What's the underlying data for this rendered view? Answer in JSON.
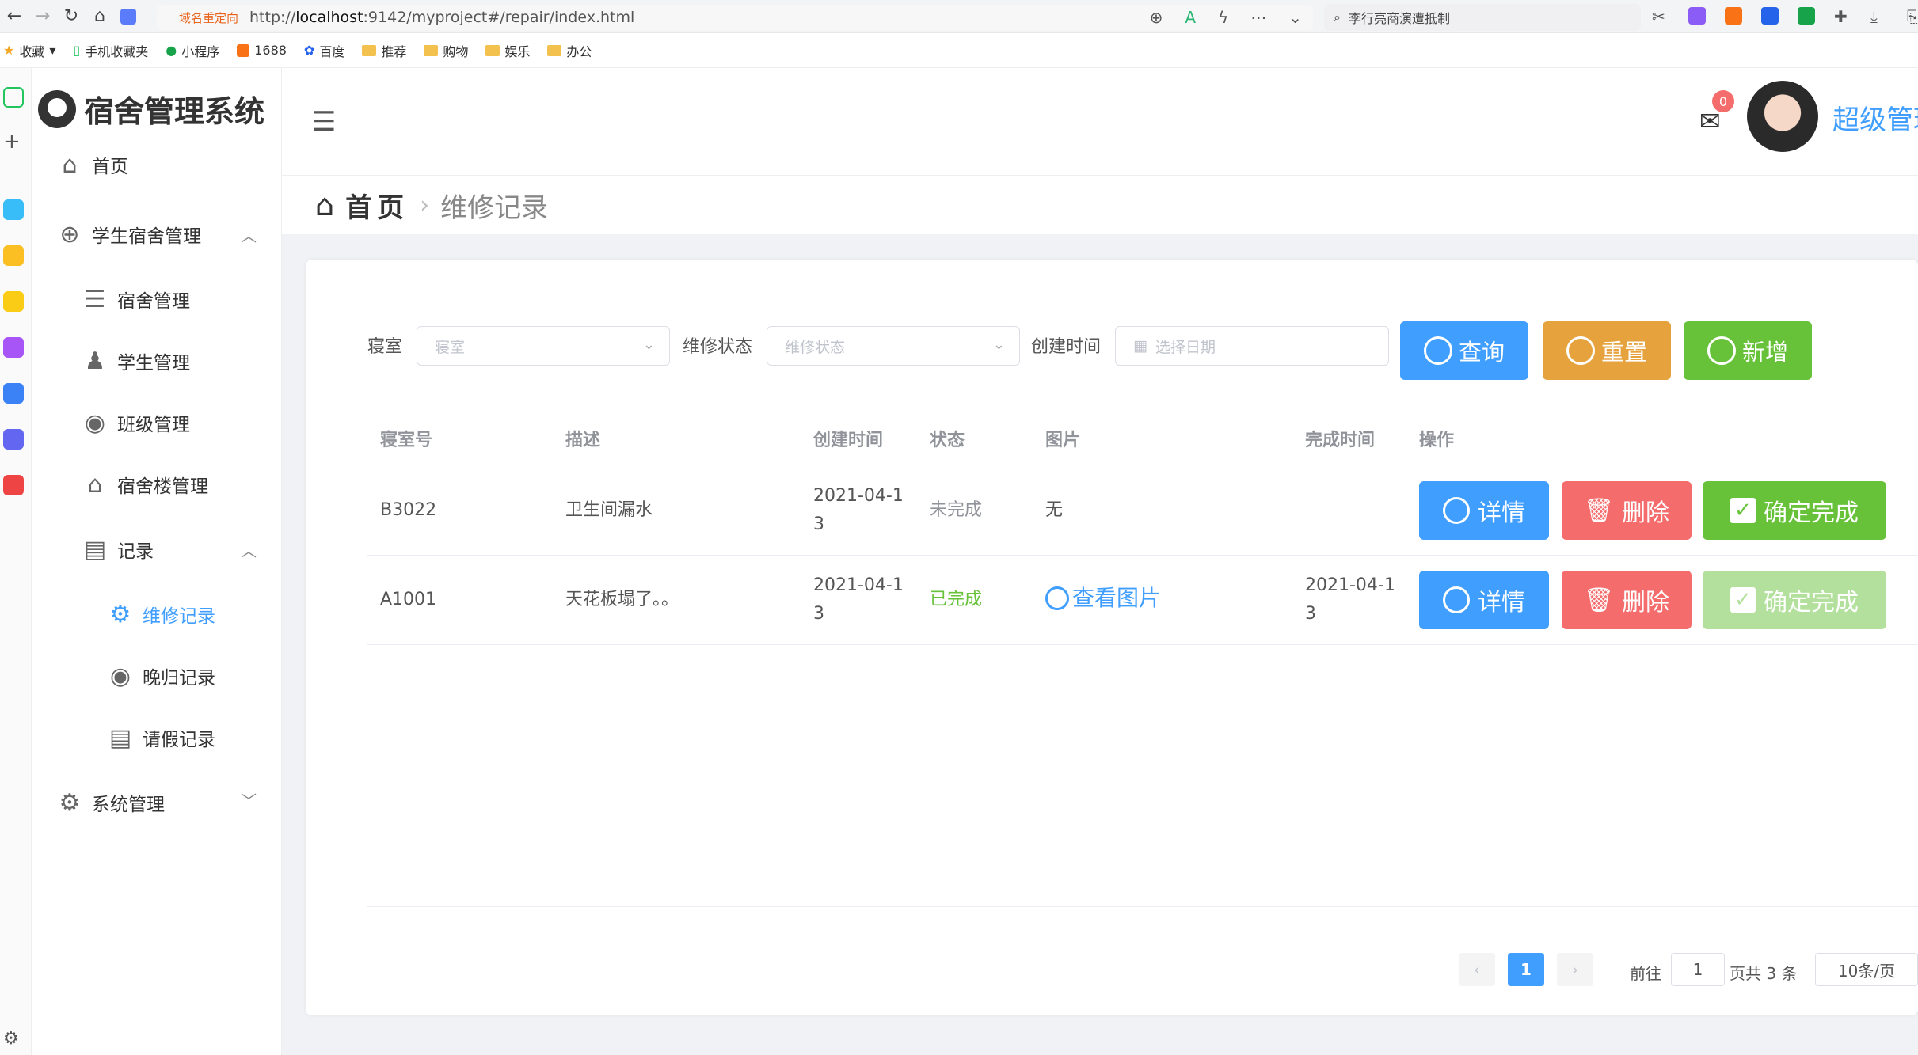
{
  "browser": {
    "redirect_label": "域名重定向",
    "url_prefix": "http://",
    "url_host": "localhost",
    "url_rest": ":9142/myproject#/repair/index.html",
    "search_text": "李行亮商演遭抵制"
  },
  "bookmarks": [
    "收藏",
    "手机收藏夹",
    "小程序",
    "1688",
    "百度",
    "推荐",
    "购物",
    "娱乐",
    "办公"
  ],
  "sidebar": {
    "app_title": "宿舍管理系统",
    "home": "首页",
    "student_dorm_mgmt": "学生宿舍管理",
    "dorm_mgmt": "宿舍管理",
    "student_mgmt": "学生管理",
    "class_mgmt": "班级管理",
    "building_mgmt": "宿舍楼管理",
    "records": "记录",
    "repair_records": "维修记录",
    "late_return_records": "晚归记录",
    "leave_records": "请假记录",
    "system_mgmt": "系统管理"
  },
  "topbar": {
    "mail_badge": "0",
    "username": "超级管理"
  },
  "breadcrumb": {
    "home": "首页",
    "current": "维修记录"
  },
  "filters": {
    "dorm_label": "寝室",
    "dorm_placeholder": "寝室",
    "status_label": "维修状态",
    "status_placeholder": "维修状态",
    "created_label": "创建时间",
    "date_placeholder": "选择日期",
    "query_btn": "查询",
    "reset_btn": "重置",
    "add_btn": "新增"
  },
  "table": {
    "headers": [
      "寝室号",
      "描述",
      "创建时间",
      "状态",
      "图片",
      "完成时间",
      "操作"
    ],
    "rows": [
      {
        "dorm": "B3022",
        "desc": "卫生间漏水",
        "created_1": "2021-04-1",
        "created_2": "3",
        "status": "未完成",
        "image": "无",
        "done_1": "",
        "done_2": "",
        "detail": "详情",
        "delete": "删除",
        "confirm": "确定完成"
      },
      {
        "dorm": "A1001",
        "desc": "天花板塌了。。",
        "created_1": "2021-04-1",
        "created_2": "3",
        "status": "已完成",
        "image": "查看图片",
        "done_1": "2021-04-1",
        "done_2": "3",
        "detail": "详情",
        "delete": "删除",
        "confirm": "确定完成"
      }
    ]
  },
  "pagination": {
    "current": "1",
    "goto_label": "前往",
    "goto_value": "1",
    "total_text": "页共 3 条",
    "page_size": "10条/页"
  }
}
